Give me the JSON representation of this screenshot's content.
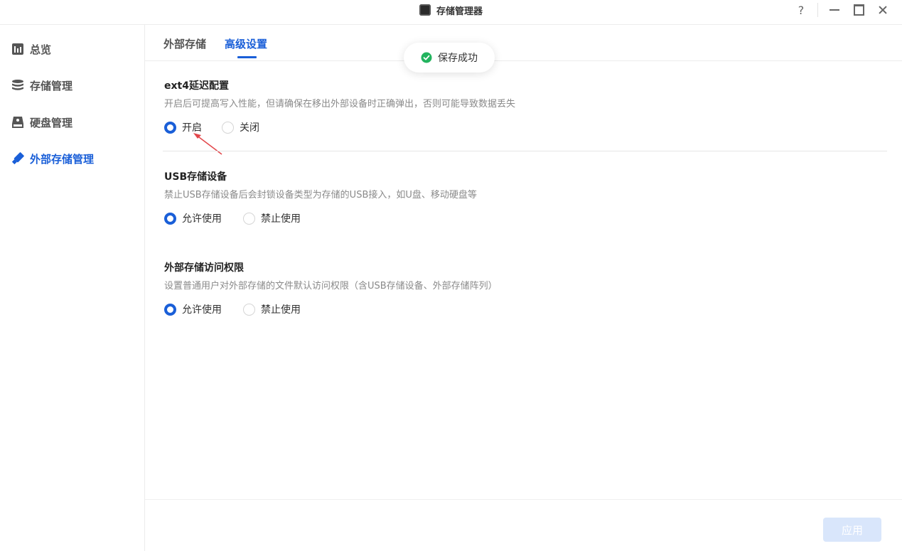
{
  "window": {
    "title": "存储管理器",
    "help_icon": "?",
    "accent_color": "#1a5fd8"
  },
  "sidebar": {
    "items": [
      {
        "label": "总览",
        "icon": "chart-icon",
        "active": false
      },
      {
        "label": "存储管理",
        "icon": "database-icon",
        "active": false
      },
      {
        "label": "硬盘管理",
        "icon": "disk-icon",
        "active": false
      },
      {
        "label": "外部存储管理",
        "icon": "usb-drive-icon",
        "active": true
      }
    ]
  },
  "tabs": [
    {
      "label": "外部存储",
      "active": false
    },
    {
      "label": "高级设置",
      "active": true
    }
  ],
  "toast": {
    "message": "保存成功",
    "icon": "check-circle-icon",
    "color": "#22b35e"
  },
  "sections": [
    {
      "title": "ext4延迟配置",
      "description": "开启后可提高写入性能，但请确保在移出外部设备时正确弹出，否则可能导致数据丢失",
      "options": [
        {
          "label": "开启",
          "checked": true
        },
        {
          "label": "关闭",
          "checked": false
        }
      ]
    },
    {
      "title": "USB存储设备",
      "description": "禁止USB存储设备后会封锁设备类型为存储的USB接入，如U盘、移动硬盘等",
      "options": [
        {
          "label": "允许使用",
          "checked": true
        },
        {
          "label": "禁止使用",
          "checked": false
        }
      ]
    },
    {
      "title": "外部存储访问权限",
      "description": "设置普通用户对外部存储的文件默认访问权限（含USB存储设备、外部存储阵列）",
      "options": [
        {
          "label": "允许使用",
          "checked": true
        },
        {
          "label": "禁止使用",
          "checked": false
        }
      ]
    }
  ],
  "footer": {
    "apply_label": "应用"
  }
}
